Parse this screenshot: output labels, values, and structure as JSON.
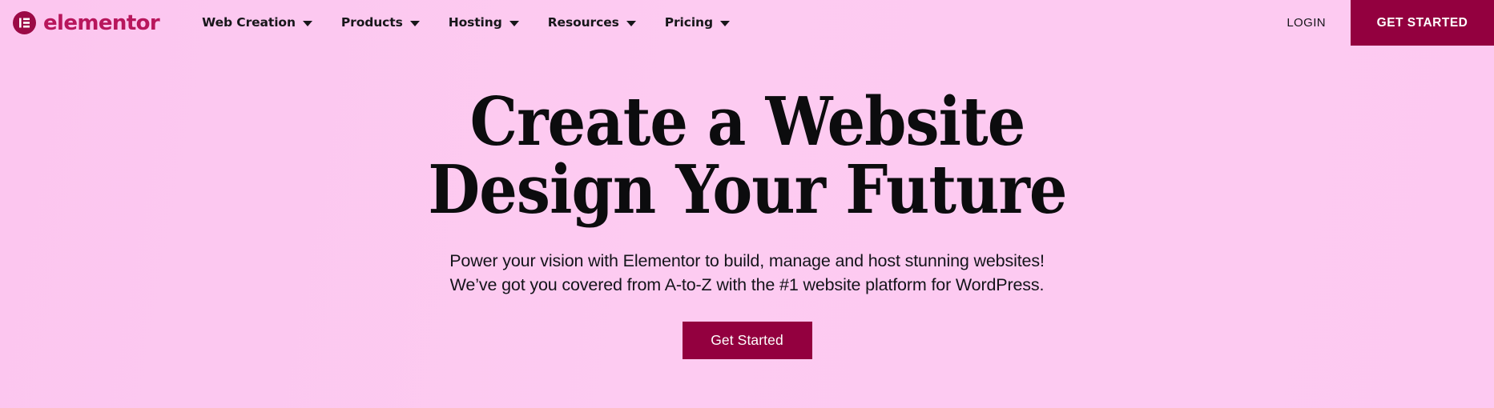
{
  "colors": {
    "background_pink": "#fdc9f1",
    "brand_magenta": "#b8165c",
    "brand_dark": "#93003f",
    "text_dark": "#17171a",
    "button_text": "#ffffff"
  },
  "header": {
    "brand": {
      "logo_icon": "elementor-logo-icon",
      "wordmark": "elementor"
    },
    "nav_items": [
      {
        "label": "Web Creation",
        "has_dropdown": true,
        "caret_icon": "chevron-down-icon"
      },
      {
        "label": "Products",
        "has_dropdown": true,
        "caret_icon": "chevron-down-icon"
      },
      {
        "label": "Hosting",
        "has_dropdown": true,
        "caret_icon": "chevron-down-icon"
      },
      {
        "label": "Resources",
        "has_dropdown": true,
        "caret_icon": "chevron-down-icon"
      },
      {
        "label": "Pricing",
        "has_dropdown": true,
        "caret_icon": "chevron-down-icon"
      }
    ],
    "login_label": "LOGIN",
    "get_started_label": "GET STARTED"
  },
  "hero": {
    "heading_line1": "Create a Website",
    "heading_line2": "Design Your Future",
    "subtitle_line1": "Power your vision with Elementor to build, manage and host stunning websites!",
    "subtitle_line2": "We’ve got you covered from A-to-Z with the #1 website platform for WordPress.",
    "cta_label": "Get Started"
  }
}
